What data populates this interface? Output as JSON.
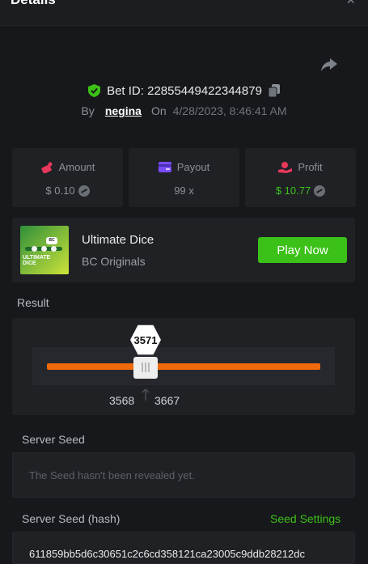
{
  "header": {
    "title": "Details",
    "close_label": "×"
  },
  "bet": {
    "id_label": "Bet ID: 22855449422344879",
    "by_label": "By",
    "username": "negina",
    "on_label": "On",
    "datetime": "4/28/2023, 8:46:41 AM"
  },
  "stats": {
    "amount_label": "Amount",
    "amount_value": "$ 0.10",
    "payout_label": "Payout",
    "payout_value": "99 x",
    "profit_label": "Profit",
    "profit_value": "$ 10.77"
  },
  "game": {
    "name": "Ultimate Dice",
    "provider": "BC Originals",
    "play_label": "Play Now",
    "thumb_line1": "ULTIMATE",
    "thumb_line2": "DICE"
  },
  "result": {
    "label": "Result",
    "roll": "3571",
    "range_low": "3568",
    "range_high": "3667"
  },
  "server_seed": {
    "label": "Server Seed",
    "placeholder": "The Seed hasn't been revealed yet."
  },
  "server_seed_hash": {
    "label": "Server Seed (hash)",
    "settings_label": "Seed Settings",
    "value": "611859bb5d6c30651c2c6cd358121ca23005c9ddb28212dc"
  },
  "colors": {
    "accent": "#3bc117",
    "orange": "#f06a0c",
    "amount_icon": "#e8385b",
    "payout_icon": "#7a4dff",
    "profit_icon": "#e8385b"
  }
}
